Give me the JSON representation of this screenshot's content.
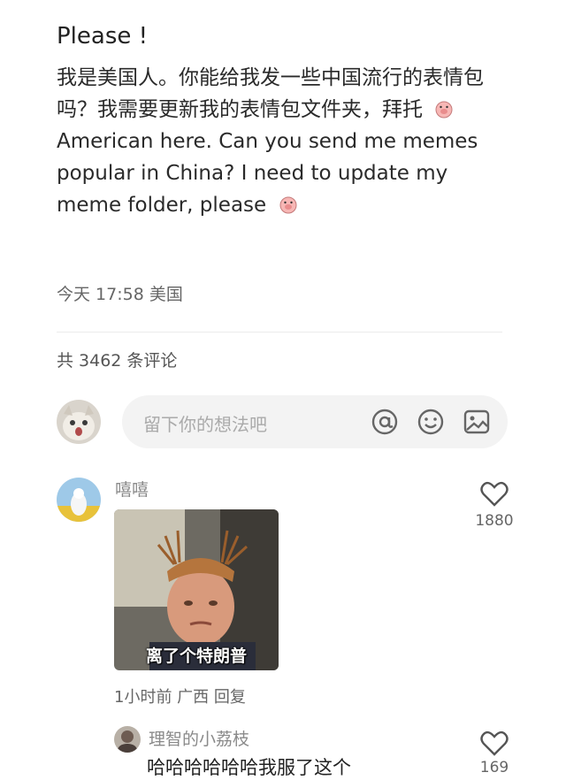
{
  "post": {
    "title": "Please !",
    "body_zh": "我是美国人。你能给我发一些中国流行的表情包吗？我需要更新我的表情包文件夹，拜托",
    "body_en": "American here. Can you send me memes popular in China? I need to update my meme folder, please",
    "meta": "今天 17:58 美国"
  },
  "comments_count": "共 3462 条评论",
  "input": {
    "placeholder": "留下你的想法吧"
  },
  "icons": [
    "at-icon",
    "smiley-icon",
    "image-icon",
    "heart-icon"
  ],
  "comments": [
    {
      "username": "嘻嘻",
      "meme_caption": "离了个特朗普",
      "likes": "1880",
      "meta": "1小时前  广西  回复"
    }
  ],
  "reply": {
    "username": "理智的小荔枝",
    "text": "哈哈哈哈哈哈我服了这个",
    "likes": "169"
  },
  "colors": {
    "accent_text": "#222222",
    "muted": "#8a8a8a",
    "input_bg": "#f3f3f3"
  }
}
